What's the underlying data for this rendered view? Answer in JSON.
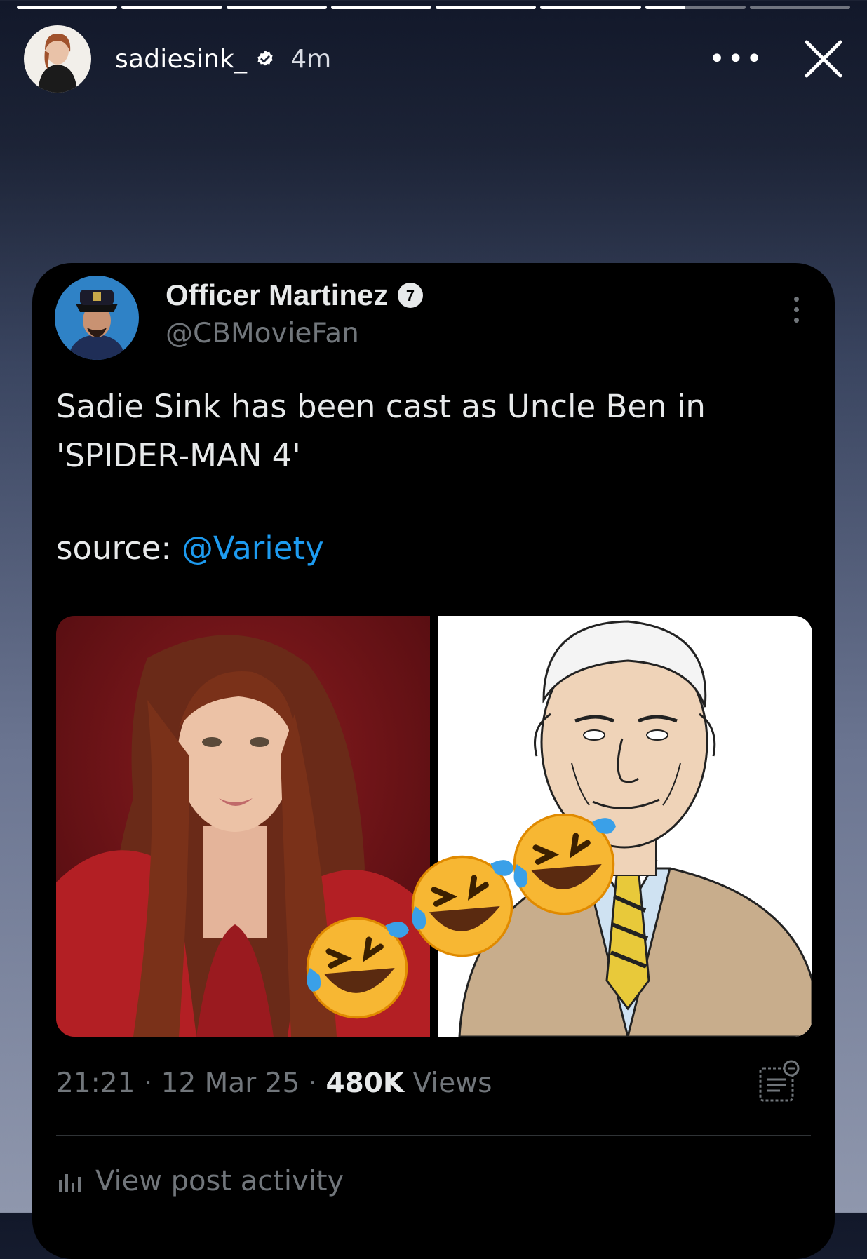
{
  "story": {
    "progress_segments": 8,
    "progress_current_index": 6,
    "progress_current_fraction": 0.4,
    "username": "sadiesink_",
    "time_ago": "4m",
    "more_icon": "more-horizontal-icon",
    "close_icon": "close-icon"
  },
  "tweet": {
    "display_name": "Officer Martinez",
    "badge_label": "7",
    "handle": "@CBMovieFan",
    "text_line1": "Sadie Sink has been cast as Uncle Ben in",
    "text_line2": "'SPIDER-MAN 4'",
    "source_prefix": "source: ",
    "source_mention": "@Variety",
    "time": "21:21",
    "date": "12 Mar 25",
    "views_count": "480K",
    "views_label": "Views",
    "separator": "·",
    "activity_label": "View post activity"
  },
  "overlay": {
    "emoji_count": 3,
    "emoji_name": "rolling-on-the-floor-laughing"
  },
  "colors": {
    "tweet_bg": "#000000",
    "mention": "#1d9bf0",
    "muted": "#71767b",
    "text": "#e7e9ea"
  }
}
